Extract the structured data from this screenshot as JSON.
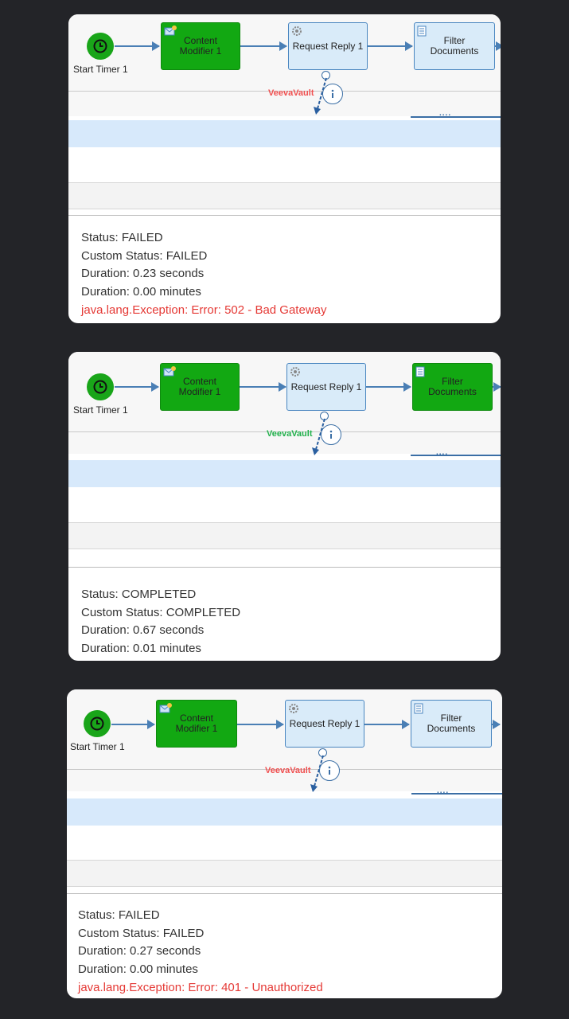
{
  "colors": {
    "background": "#232428",
    "success_green": "#12a812",
    "step_blue": "#d9ebf9",
    "connector_blue": "#4a7fb5",
    "error_red": "#e53935",
    "vault_ok": "#22b14c",
    "vault_fail": "#f05050"
  },
  "runs": [
    {
      "flow": {
        "start_label": "Start Timer 1",
        "content_modifier": "Content Modifier 1",
        "request_reply": "Request Reply 1",
        "filter": "Filter Documents",
        "receiver": "VeevaVault",
        "filter_state": "pending",
        "receiver_state": "failed"
      },
      "status": "Status: FAILED",
      "custom_status": "Custom Status: FAILED",
      "duration_seconds": "Duration: 0.23 seconds",
      "duration_minutes": "Duration: 0.00 minutes",
      "error": "java.lang.Exception: Error: 502 - Bad Gateway"
    },
    {
      "flow": {
        "start_label": "Start Timer 1",
        "content_modifier": "Content Modifier 1",
        "request_reply": "Request Reply 1",
        "filter": "Filter Documents",
        "receiver": "VeevaVault",
        "filter_state": "completed",
        "receiver_state": "ok"
      },
      "status": "Status: COMPLETED",
      "custom_status": "Custom Status: COMPLETED",
      "duration_seconds": "Duration: 0.67 seconds",
      "duration_minutes": "Duration: 0.01 minutes"
    },
    {
      "flow": {
        "start_label": "Start Timer 1",
        "content_modifier": "Content Modifier 1",
        "request_reply": "Request Reply 1",
        "filter": "Filter Documents",
        "receiver": "VeevaVault",
        "filter_state": "pending",
        "receiver_state": "failed"
      },
      "status": "Status: FAILED",
      "custom_status": "Custom Status: FAILED",
      "duration_seconds": "Duration: 0.27 seconds",
      "duration_minutes": "Duration: 0.00 minutes",
      "error": "java.lang.Exception: Error: 401 - Unauthorized"
    }
  ]
}
